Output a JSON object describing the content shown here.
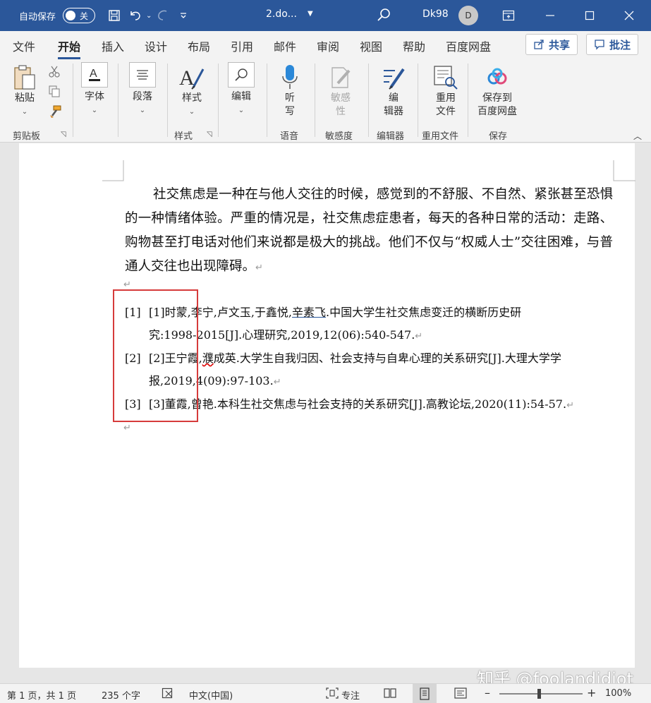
{
  "titlebar": {
    "autosave_label": "自动保存",
    "autosave_state": "关",
    "doc_title": "2.do...",
    "user": "Dk98",
    "avatar_initial": "D"
  },
  "menu": {
    "tabs": [
      "文件",
      "开始",
      "插入",
      "设计",
      "布局",
      "引用",
      "邮件",
      "审阅",
      "视图",
      "帮助",
      "百度网盘"
    ],
    "active": "开始",
    "share": "共享",
    "comment": "批注"
  },
  "ribbon": {
    "paste": "粘贴",
    "font": "字体",
    "paragraph": "段落",
    "styles": "样式",
    "edit": "编辑",
    "dictate_1": "听",
    "dictate_2": "写",
    "sensitivity_1": "敏感",
    "sensitivity_2": "性",
    "editor_1": "编",
    "editor_2": "辑器",
    "reuse_1": "重用",
    "reuse_2": "文件",
    "baidu_1": "保存到",
    "baidu_2": "百度网盘",
    "groups": {
      "clipboard": "剪贴板",
      "styles": "样式",
      "voice": "语音",
      "sensitivity": "敏感度",
      "editor": "编辑器",
      "reuse": "重用文件",
      "save": "保存"
    }
  },
  "document": {
    "paragraph": "社交焦虑是一种在与他人交往的时候，感觉到的不舒服、不自然、紧张甚至恐惧的一种情绪体验。严重的情况是，社交焦虑症患者，每天的各种日常的活动：走路、购物甚至打电话对他们来说都是极大的挑战。他们不仅与“权威人士”交往困难，与普通人交往也出现障碍。",
    "return_mark": "↵",
    "refs": [
      {
        "num": "[1]",
        "pre": "[1]时蒙,李宁,卢文玉,于鑫悦,",
        "underlined": "辛素飞",
        "line1_rest": ".中国大学生社交焦虑变迁的横断历史研",
        "line2": "究:1998-2015[J].心理研究,2019,12(06):540-547."
      },
      {
        "num": "[2]",
        "pre": "[2]王宁霞,",
        "squiggle": "濮",
        "line1_rest": "成英.大学生自我归因、社会支持与自卑心理的关系研究[J].大理大学学",
        "line2": "报,2019,4(09):97-103."
      },
      {
        "num": "[3]",
        "line1": "[3]董霞,曾艳.本科生社交焦虑与社会支持的关系研究[J].高教论坛,2020(11):54-57."
      }
    ]
  },
  "statusbar": {
    "page": "第 1 页，共 1 页",
    "words": "235 个字",
    "language": "中文(中国)",
    "focus": "专注",
    "zoom": "100%",
    "zoom_level": 1.0
  },
  "watermark": "知乎 @foolandidiot",
  "colors": {
    "accent": "#2b579a",
    "highlight_box": "#d63b3b"
  }
}
